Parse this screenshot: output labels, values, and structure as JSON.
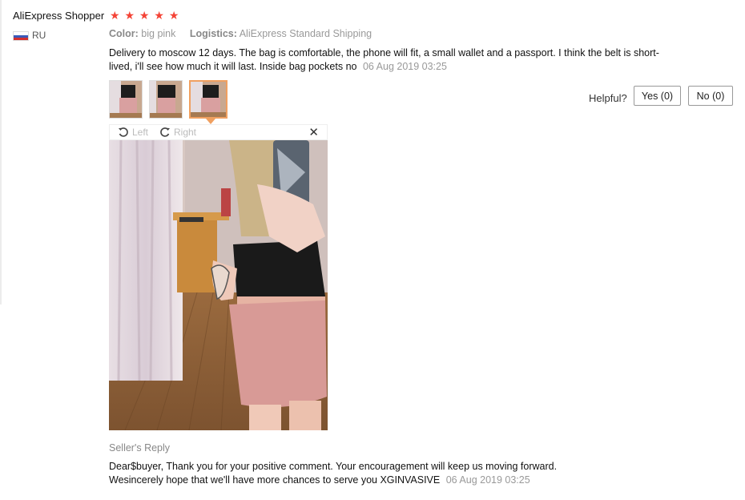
{
  "review": {
    "buyer_name": "AliExpress Shopper",
    "stars": [
      "★",
      "★",
      "★",
      "★",
      "★"
    ],
    "country": "RU",
    "color_label": "Color:",
    "color_value": "big pink",
    "logistics_label": "Logistics:",
    "logistics_value": "AliExpress Standard Shipping",
    "text": "Delivery to moscow 12 days. The bag is comfortable, the phone will fit, a small wallet and a passport. I think the belt is short-lived, i'll see how much it will last. Inside bag pockets no",
    "date": "06 Aug 2019 03:25"
  },
  "helpful": {
    "label": "Helpful?",
    "yes_label": "Yes (0)",
    "no_label": "No (0)"
  },
  "viewer": {
    "rotate_left_label": "Left",
    "rotate_right_label": "Right",
    "close_label": "✕",
    "thumbnail_count": 3,
    "selected_thumbnail": 3
  },
  "reply": {
    "title": "Seller's Reply",
    "line1": "Dear$buyer, Thank you for your positive comment. Your encouragement will keep us moving forward.",
    "line2": "Wesincerely hope that we'll have more chances to serve you XGINVASIVE",
    "date": "06 Aug 2019 03:25"
  },
  "colors": {
    "star": "#f44336",
    "active_thumb_border": "#f0a060",
    "muted_text": "#999999"
  }
}
